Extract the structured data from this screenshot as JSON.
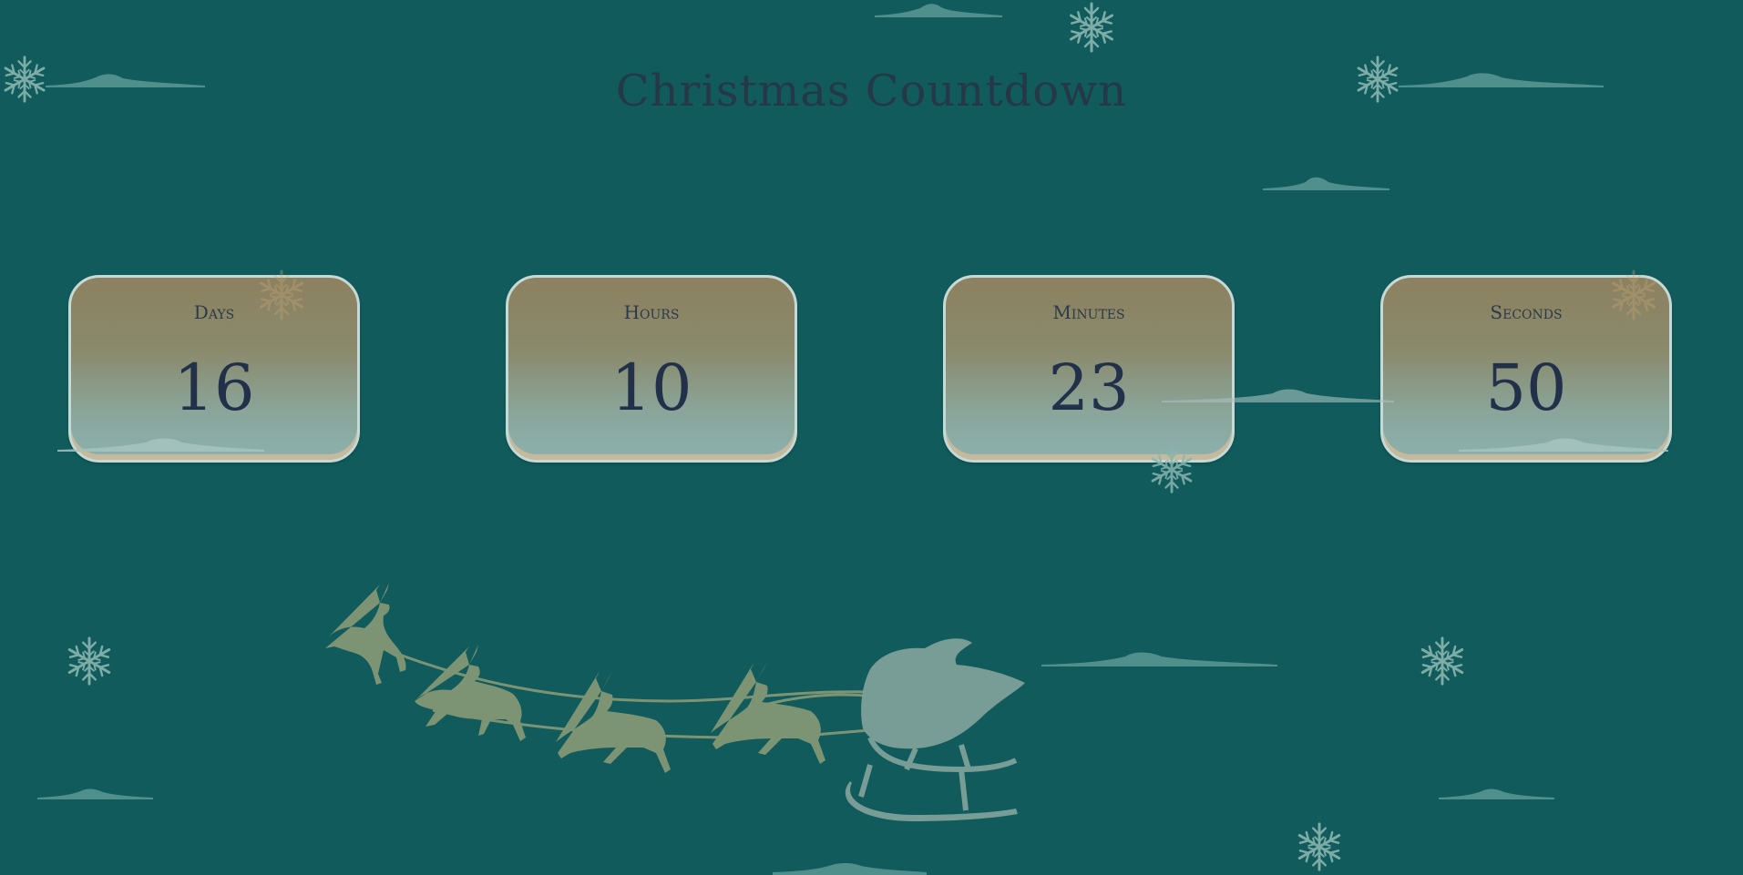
{
  "page": {
    "title": "Christmas Countdown",
    "background_color": "#115b5c",
    "text_color": "#243848"
  },
  "countdown": [
    {
      "label": "Days",
      "value": "16"
    },
    {
      "label": "Hours",
      "value": "10"
    },
    {
      "label": "Minutes",
      "value": "23"
    },
    {
      "label": "Seconds",
      "value": "50"
    }
  ],
  "decorations": {
    "snowflake_icon": "snowflake-icon",
    "cloud_icon": "cloud-icon",
    "sleigh_icon": "santa-sleigh-reindeer-icon",
    "snowflake_color": "#8ab5b0",
    "cloud_color": "#4f8f8c",
    "reindeer_color": "#7d9474",
    "sleigh_color": "#789c96"
  }
}
